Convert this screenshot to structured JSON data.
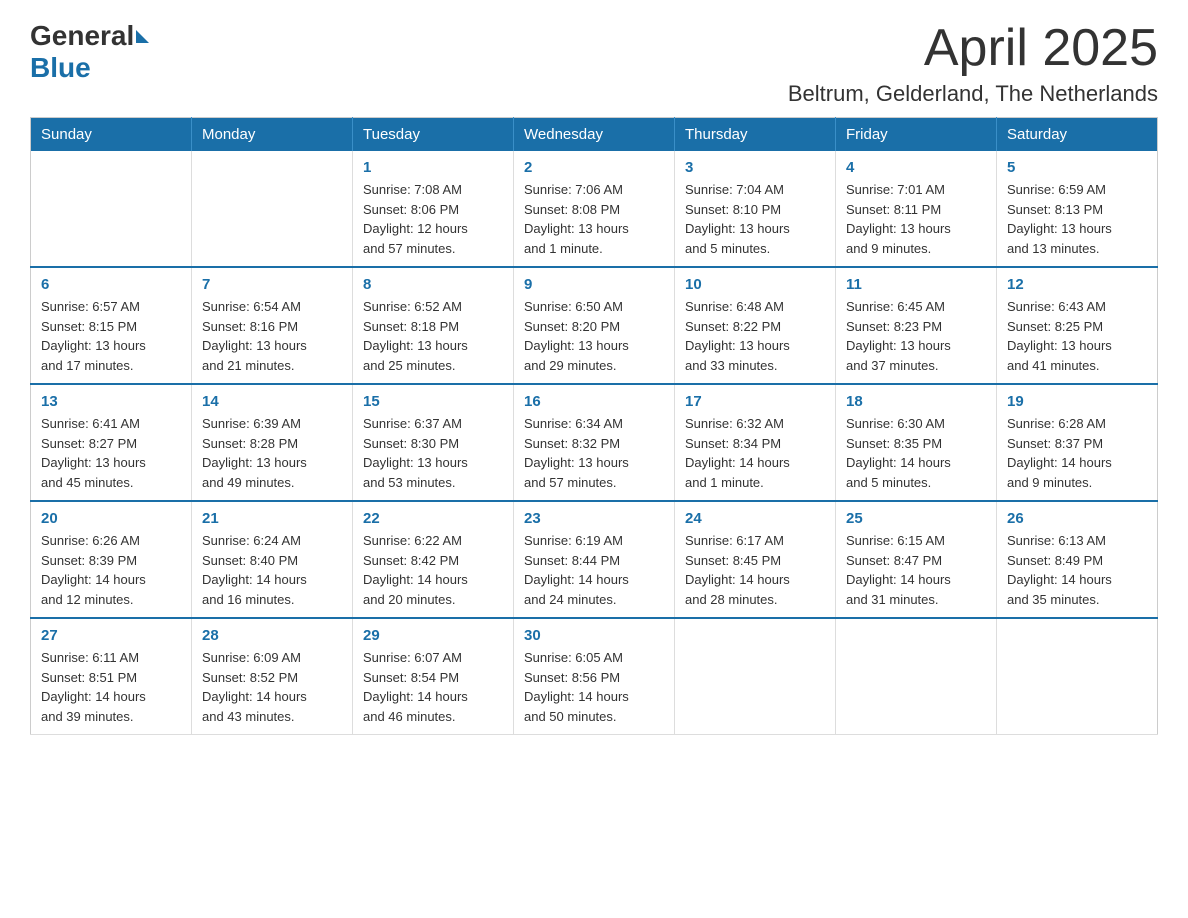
{
  "header": {
    "logo_general": "General",
    "logo_blue": "Blue",
    "month_year": "April 2025",
    "location": "Beltrum, Gelderland, The Netherlands"
  },
  "weekdays": [
    "Sunday",
    "Monday",
    "Tuesday",
    "Wednesday",
    "Thursday",
    "Friday",
    "Saturday"
  ],
  "weeks": [
    [
      {
        "day": "",
        "info": ""
      },
      {
        "day": "",
        "info": ""
      },
      {
        "day": "1",
        "info": "Sunrise: 7:08 AM\nSunset: 8:06 PM\nDaylight: 12 hours\nand 57 minutes."
      },
      {
        "day": "2",
        "info": "Sunrise: 7:06 AM\nSunset: 8:08 PM\nDaylight: 13 hours\nand 1 minute."
      },
      {
        "day": "3",
        "info": "Sunrise: 7:04 AM\nSunset: 8:10 PM\nDaylight: 13 hours\nand 5 minutes."
      },
      {
        "day": "4",
        "info": "Sunrise: 7:01 AM\nSunset: 8:11 PM\nDaylight: 13 hours\nand 9 minutes."
      },
      {
        "day": "5",
        "info": "Sunrise: 6:59 AM\nSunset: 8:13 PM\nDaylight: 13 hours\nand 13 minutes."
      }
    ],
    [
      {
        "day": "6",
        "info": "Sunrise: 6:57 AM\nSunset: 8:15 PM\nDaylight: 13 hours\nand 17 minutes."
      },
      {
        "day": "7",
        "info": "Sunrise: 6:54 AM\nSunset: 8:16 PM\nDaylight: 13 hours\nand 21 minutes."
      },
      {
        "day": "8",
        "info": "Sunrise: 6:52 AM\nSunset: 8:18 PM\nDaylight: 13 hours\nand 25 minutes."
      },
      {
        "day": "9",
        "info": "Sunrise: 6:50 AM\nSunset: 8:20 PM\nDaylight: 13 hours\nand 29 minutes."
      },
      {
        "day": "10",
        "info": "Sunrise: 6:48 AM\nSunset: 8:22 PM\nDaylight: 13 hours\nand 33 minutes."
      },
      {
        "day": "11",
        "info": "Sunrise: 6:45 AM\nSunset: 8:23 PM\nDaylight: 13 hours\nand 37 minutes."
      },
      {
        "day": "12",
        "info": "Sunrise: 6:43 AM\nSunset: 8:25 PM\nDaylight: 13 hours\nand 41 minutes."
      }
    ],
    [
      {
        "day": "13",
        "info": "Sunrise: 6:41 AM\nSunset: 8:27 PM\nDaylight: 13 hours\nand 45 minutes."
      },
      {
        "day": "14",
        "info": "Sunrise: 6:39 AM\nSunset: 8:28 PM\nDaylight: 13 hours\nand 49 minutes."
      },
      {
        "day": "15",
        "info": "Sunrise: 6:37 AM\nSunset: 8:30 PM\nDaylight: 13 hours\nand 53 minutes."
      },
      {
        "day": "16",
        "info": "Sunrise: 6:34 AM\nSunset: 8:32 PM\nDaylight: 13 hours\nand 57 minutes."
      },
      {
        "day": "17",
        "info": "Sunrise: 6:32 AM\nSunset: 8:34 PM\nDaylight: 14 hours\nand 1 minute."
      },
      {
        "day": "18",
        "info": "Sunrise: 6:30 AM\nSunset: 8:35 PM\nDaylight: 14 hours\nand 5 minutes."
      },
      {
        "day": "19",
        "info": "Sunrise: 6:28 AM\nSunset: 8:37 PM\nDaylight: 14 hours\nand 9 minutes."
      }
    ],
    [
      {
        "day": "20",
        "info": "Sunrise: 6:26 AM\nSunset: 8:39 PM\nDaylight: 14 hours\nand 12 minutes."
      },
      {
        "day": "21",
        "info": "Sunrise: 6:24 AM\nSunset: 8:40 PM\nDaylight: 14 hours\nand 16 minutes."
      },
      {
        "day": "22",
        "info": "Sunrise: 6:22 AM\nSunset: 8:42 PM\nDaylight: 14 hours\nand 20 minutes."
      },
      {
        "day": "23",
        "info": "Sunrise: 6:19 AM\nSunset: 8:44 PM\nDaylight: 14 hours\nand 24 minutes."
      },
      {
        "day": "24",
        "info": "Sunrise: 6:17 AM\nSunset: 8:45 PM\nDaylight: 14 hours\nand 28 minutes."
      },
      {
        "day": "25",
        "info": "Sunrise: 6:15 AM\nSunset: 8:47 PM\nDaylight: 14 hours\nand 31 minutes."
      },
      {
        "day": "26",
        "info": "Sunrise: 6:13 AM\nSunset: 8:49 PM\nDaylight: 14 hours\nand 35 minutes."
      }
    ],
    [
      {
        "day": "27",
        "info": "Sunrise: 6:11 AM\nSunset: 8:51 PM\nDaylight: 14 hours\nand 39 minutes."
      },
      {
        "day": "28",
        "info": "Sunrise: 6:09 AM\nSunset: 8:52 PM\nDaylight: 14 hours\nand 43 minutes."
      },
      {
        "day": "29",
        "info": "Sunrise: 6:07 AM\nSunset: 8:54 PM\nDaylight: 14 hours\nand 46 minutes."
      },
      {
        "day": "30",
        "info": "Sunrise: 6:05 AM\nSunset: 8:56 PM\nDaylight: 14 hours\nand 50 minutes."
      },
      {
        "day": "",
        "info": ""
      },
      {
        "day": "",
        "info": ""
      },
      {
        "day": "",
        "info": ""
      }
    ]
  ],
  "colors": {
    "header_bg": "#1a6fa8",
    "accent_blue": "#1a6fa8",
    "text_dark": "#333333",
    "border_light": "#cccccc"
  }
}
